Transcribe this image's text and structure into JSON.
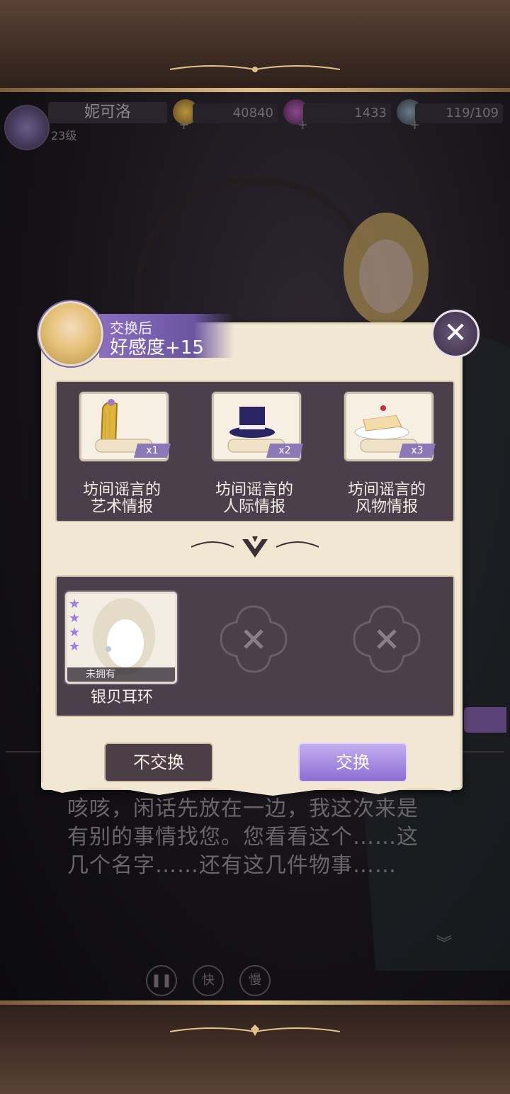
{
  "status_bar": {
    "player_name": "妮可洛",
    "level": "23级",
    "gold": "40840",
    "gems": "1433",
    "stamina": "119/109"
  },
  "modal": {
    "header_sub": "交换后",
    "header_main": "好感度+15",
    "items": [
      {
        "label_line1": "坊间谣言的",
        "label_line2": "艺术情报",
        "qty": "x1",
        "icon": "harp-scroll-icon"
      },
      {
        "label_line1": "坊间谣言的",
        "label_line2": "人际情报",
        "qty": "x2",
        "icon": "top-hat-scroll-icon"
      },
      {
        "label_line1": "坊间谣言的",
        "label_line2": "风物情报",
        "qty": "x3",
        "icon": "cake-scroll-icon"
      }
    ],
    "reward": {
      "name": "银贝耳环",
      "ownership": "未拥有",
      "stars": 4
    },
    "decline_label": "不交换",
    "accept_label": "交换"
  },
  "dialogue": {
    "text_line1": "咳咳，闲话先放在一边，我这次来是",
    "text_line2": "有别的事情找您。您看看这个……这",
    "text_line3": "几个名字……还有这几件物事……"
  },
  "controls": {
    "pause": "❚❚",
    "fast": "快",
    "slow": "慢"
  },
  "colors": {
    "accent_purple": "#8c6ed4",
    "panel_bg": "#4a3f4a",
    "parchment": "#f1e7d3"
  }
}
